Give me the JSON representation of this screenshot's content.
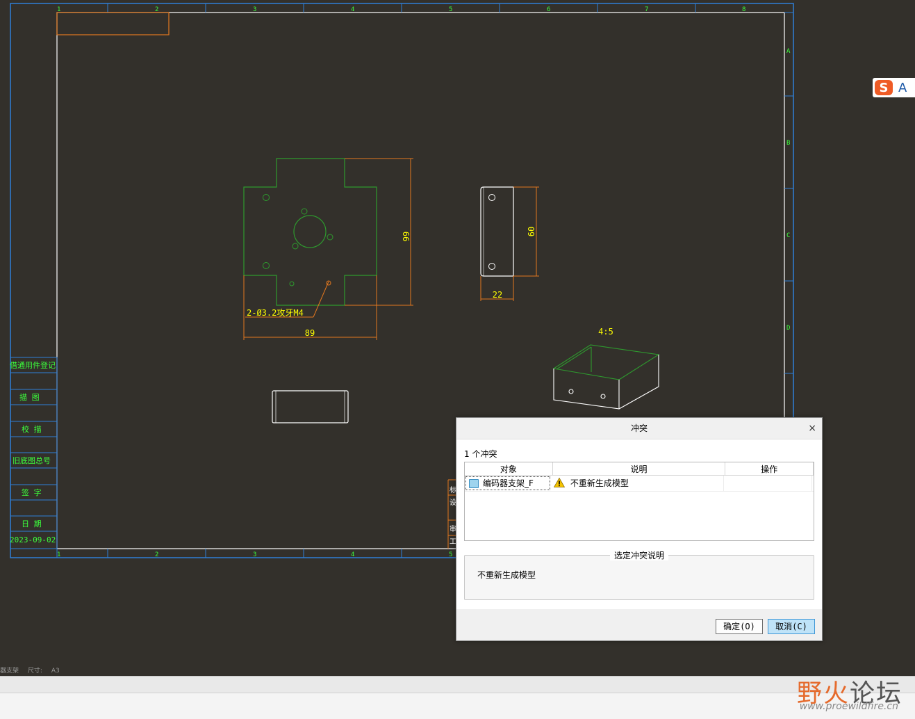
{
  "drawing": {
    "zone_numbers_top": [
      "1",
      "2",
      "3",
      "4",
      "5",
      "6",
      "7",
      "8"
    ],
    "zone_numbers_bottom": [
      "1",
      "2",
      "3",
      "4",
      "5"
    ],
    "zone_letters_right": [
      "A",
      "B",
      "C",
      "D"
    ],
    "side_table": [
      "借通用件登记",
      "描  图",
      "校  描",
      "旧底图总号",
      "签  字",
      "日  期",
      "2023-09-02"
    ],
    "dims": {
      "height_99": "99",
      "width_89": "89",
      "height_60": "60",
      "width_22": "22",
      "hole_note": "2-Ø3.2攻牙M4",
      "scale": "4:5"
    },
    "title_block_chars": [
      "标",
      "设",
      "审",
      "工"
    ],
    "colors": {
      "background": "#33302b",
      "frame": "#2f7fd8",
      "sheet": "#ffffff",
      "dim": "#e3781f",
      "geometry": "#2e9a2e",
      "text": "#ffff00",
      "zone_text": "#3cff3c"
    }
  },
  "status": {
    "left": "器支架",
    "size_label": "尺寸:",
    "size_value": "A3"
  },
  "ime": {
    "logo": "S",
    "mode": "A"
  },
  "watermark": {
    "text_a": "野",
    "text_b": "火",
    "text_c": "论坛",
    "url": "www.proewildfire.cn"
  },
  "dialog": {
    "title": "冲突",
    "close_icon": "×",
    "conflict_count": "1 个冲突",
    "columns": [
      "对象",
      "说明",
      "操作"
    ],
    "rows": [
      {
        "object": "编码器支架_F",
        "description": "不重新生成模型",
        "action": ""
      }
    ],
    "detail_group_label": "选定冲突说明",
    "detail_text": "不重新生成模型",
    "ok_label": "确定(O)",
    "cancel_label": "取消(C)"
  }
}
